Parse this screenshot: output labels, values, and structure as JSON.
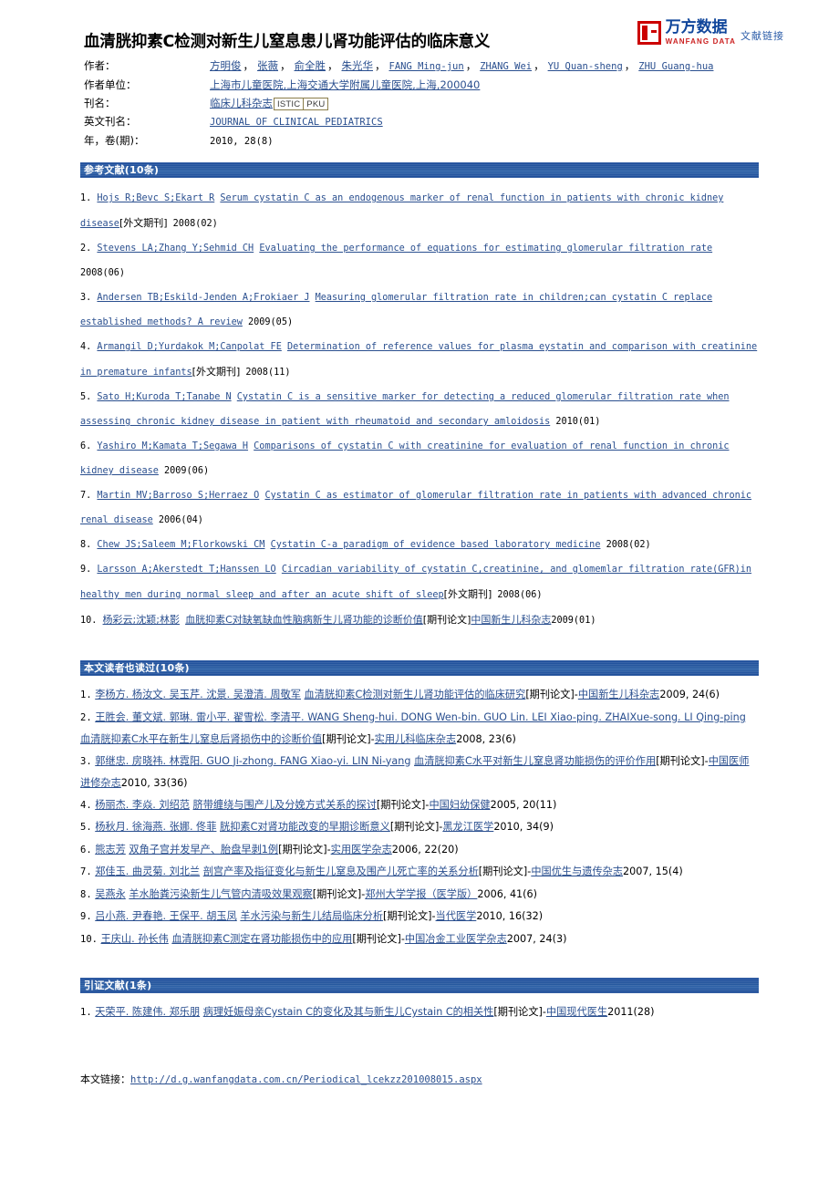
{
  "brand": {
    "logo_cn": "万方数据",
    "logo_en": "WANFANG DATA",
    "logo_tag": "文献链接",
    "accent_blue": "#1f4e9c",
    "link_blue": "#2a4f8f",
    "logo_red": "#cc0000"
  },
  "title": "血清胱抑素C检测对新生儿窒息患儿肾功能评估的临床意义",
  "meta": {
    "rows": [
      {
        "label": "作者：",
        "type": "authors"
      },
      {
        "label": "作者单位：",
        "type": "affiliation"
      },
      {
        "label": "刊名：",
        "type": "journal"
      },
      {
        "label": "英文刊名：",
        "type": "journal_en"
      },
      {
        "label": "年，卷(期)：",
        "type": "year"
      }
    ],
    "authors": [
      "方明俊",
      "张薇",
      "俞全胜",
      "朱光华",
      "FANG Ming-jun",
      "ZHANG Wei",
      "YU Quan-sheng",
      "ZHU Guang-hua"
    ],
    "authors_cn_count": 4,
    "affiliation": "上海市儿童医院,上海交通大学附属儿童医院,上海,200040",
    "journal": "临床儿科杂志",
    "journal_badges": [
      "ISTIC",
      "PKU"
    ],
    "journal_en": "JOURNAL OF CLINICAL PEDIATRICS",
    "year_volume_issue": "2010, 28(8)"
  },
  "sections": {
    "references": {
      "heading": "参考文献(10条)",
      "items": [
        {
          "num": "1.",
          "authors": "Hojs R;Bevc S;Ekart R",
          "title": "Serum cystatin C as an endogenous marker of renal function in patients with chronic kidney disease",
          "tag": "[外文期刊]",
          "year": "2008(02)"
        },
        {
          "num": "2.",
          "authors": "Stevens LA;Zhang Y;Sehmid CH",
          "title": "Evaluating the performance of equations for estimating glomerular filtration rate",
          "tag": "",
          "year": "2008(06)"
        },
        {
          "num": "3.",
          "authors": "Andersen TB;Eskild-Jenden A;Frokiaer J",
          "title": "Measuring glomerular filtration rate in children;can cystatin C replace established methods? A review",
          "tag": "",
          "year": "2009(05)"
        },
        {
          "num": "4.",
          "authors": "Armangil D;Yurdakok M;Canpolat FE",
          "title": "Determination of reference values for plasma eystatin and comparison with creatinine in premature infants",
          "tag": "[外文期刊]",
          "year": "2008(11)"
        },
        {
          "num": "5.",
          "authors": "Sato H;Kuroda T;Tanabe N",
          "title": "Cystatin C is a sensitive marker for detecting a reduced glomerular filtration rate when assessing chronic kidney disease in patient with rheumatoid and secondary amloidosis",
          "tag": "",
          "year": "2010(01)"
        },
        {
          "num": "6.",
          "authors": "Yashiro M;Kamata T;Segawa H",
          "title": "Comparisons of cystatin C with creatinine for evaluation of renal function in chronic kidney disease",
          "tag": "",
          "year": "2009(06)"
        },
        {
          "num": "7.",
          "authors": "Martin MV;Barroso S;Herraez O",
          "title": "Cystatin C as estimator of glomerular filtration rate in patients with advanced chronic renal disease",
          "tag": "",
          "year": "2006(04)"
        },
        {
          "num": "8.",
          "authors": "Chew JS;Saleem M;Florkowski CM",
          "title": "Cystatin C-a paradigm of evidence based laboratory medicine",
          "tag": "",
          "year": "2008(02)"
        },
        {
          "num": "9.",
          "authors": "Larsson A;Akerstedt T;Hanssen LO",
          "title": "Circadian variability of cystatin C,creatinine, and glomemlar filtration rate(GFR)in healthy men during normal sleep and after an acute shift of sleep",
          "tag": "[外文期刊]",
          "year": "2008(06)"
        },
        {
          "num": "10.",
          "authors": "杨彩云;沈颖;林影",
          "title": "血胱抑素C对缺氧缺血性脑病新生儿肾功能的诊断价值",
          "tag": "[期刊论文]",
          "journal": "中国新生儿科杂志",
          "year": "2009(01)"
        }
      ]
    },
    "also_read": {
      "heading": "本文读者也读过(10条)",
      "items": [
        {
          "num": "1.",
          "authors": "李杨方. 杨汝文. 吴玉芹. 沈景. 吴澄清. 周敬军",
          "title": "血清胱抑素C检测对新生儿肾功能评估的临床研究",
          "tag": "[期刊论文]-",
          "journal": "中国新生儿科杂志",
          "year": "2009, 24(6)"
        },
        {
          "num": "2.",
          "authors": "王胜会. 董文斌. 郭琳. 雷小平. 翟雪松. 李清平. WANG Sheng-hui. DONG Wen-bin. GUO Lin. LEI Xiao-ping. ZHAIXue-song. LI Qing-ping",
          "title": "血清胱抑素C水平在新生儿窒息后肾损伤中的诊断价值",
          "tag": "[期刊论文]-",
          "journal": "实用儿科临床杂志",
          "year": "2008, 23(6)"
        },
        {
          "num": "3.",
          "authors": "郭继忠. 房晓祎. 林霓阳. GUO Ji-zhong. FANG Xiao-yi. LIN Ni-yang",
          "title": "血清胱抑素C水平对新生儿窒息肾功能损伤的评价作用",
          "tag": "[期刊论文]-",
          "journal": "中国医师进修杂志",
          "year": "2010, 33(36)"
        },
        {
          "num": "4.",
          "authors": "杨丽杰. 李焱. 刘绍范",
          "title": "脐带缠绕与围产儿及分娩方式关系的探讨",
          "tag": "[期刊论文]-",
          "journal": "中国妇幼保健",
          "year": "2005, 20(11)"
        },
        {
          "num": "5.",
          "authors": "杨秋月. 徐海燕. 张娜. 佟菲",
          "title": "胱抑素C对肾功能改变的早期诊断意义",
          "tag": "[期刊论文]-",
          "journal": "黑龙江医学",
          "year": "2010, 34(9)"
        },
        {
          "num": "6.",
          "authors": "熊志芳",
          "title": "双角子宫并发早产、胎盘早剥1例",
          "tag": "[期刊论文]-",
          "journal": "实用医学杂志",
          "year": "2006, 22(20)"
        },
        {
          "num": "7.",
          "authors": "郑佳玉. 曲灵菊. 刘北兰",
          "title": "剖宫产率及指征变化与新生儿窒息及围产儿死亡率的关系分析",
          "tag": "[期刊论文]-",
          "journal": "中国优生与遗传杂志",
          "year": "2007, 15(4)"
        },
        {
          "num": "8.",
          "authors": "吴燕永",
          "title": "羊水胎粪污染新生儿气管内清吸效果观察",
          "tag": "[期刊论文]-",
          "journal": "郑州大学学报（医学版）",
          "year": "2006, 41(6)"
        },
        {
          "num": "9.",
          "authors": "吕小燕. 尹春艳. 王保平. 胡玉凤",
          "title": "羊水污染与新生儿结局临床分析",
          "tag": "[期刊论文]-",
          "journal": "当代医学",
          "year": "2010, 16(32)"
        },
        {
          "num": "10.",
          "authors": "王庆山. 孙长伟",
          "title": "血清胱抑素C测定在肾功能损伤中的应用",
          "tag": "[期刊论文]-",
          "journal": "中国冶金工业医学杂志",
          "year": "2007, 24(3)"
        }
      ]
    },
    "citing": {
      "heading": "引证文献(1条)",
      "items": [
        {
          "num": "1.",
          "authors": "天荣平. 陈建伟. 郑乐朋",
          "title": "病理妊娠母亲Cystain C的变化及其与新生儿Cystain C的相关性",
          "tag": "[期刊论文]-",
          "journal": "中国现代医生",
          "year": "2011(28)"
        }
      ]
    }
  },
  "footer": {
    "label": "本文链接：",
    "url": "http://d.g.wanfangdata.com.cn/Periodical_lcekzz201008015.aspx"
  }
}
